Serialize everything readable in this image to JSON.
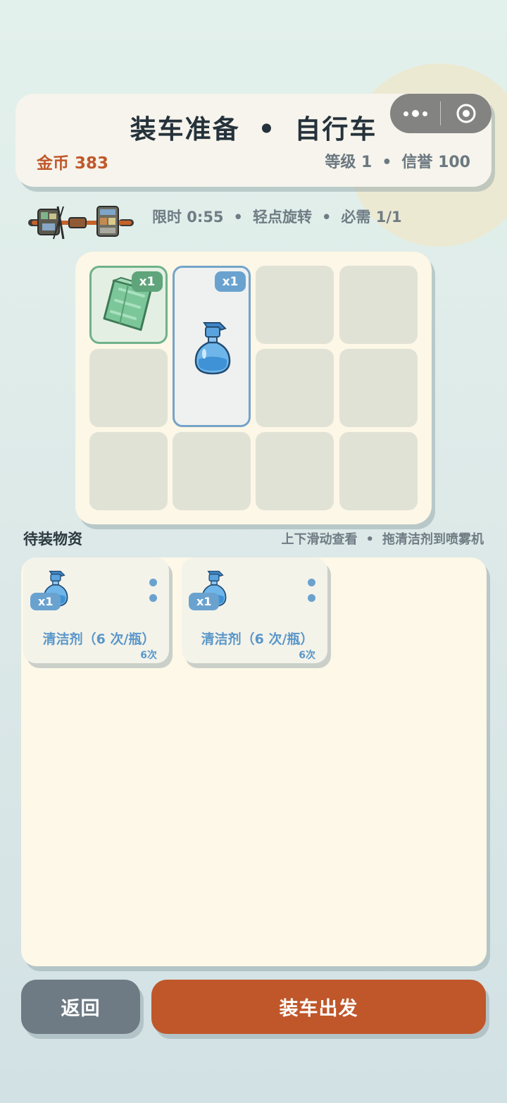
{
  "header": {
    "title_left": "装车准备",
    "title_sep": "•",
    "title_right": "自行车",
    "coins": "金币 383",
    "level": "等级 1",
    "stats_sep": "•",
    "reputation": "信誉 100"
  },
  "info": {
    "timer": "限时 0:55",
    "hint": "轻点旋转",
    "required": "必需 1/1",
    "sep": "•"
  },
  "board": {
    "items": [
      {
        "name": "towel",
        "qty": "x1",
        "accent": "#6fb28a"
      },
      {
        "name": "spray-bottle",
        "qty": "x1",
        "accent": "#75a3c9"
      }
    ]
  },
  "pending": {
    "title": "待装物资",
    "hint_scroll": "上下滑动查看",
    "hint_sep": "•",
    "hint_drag": "拖清洁剂到喷雾机",
    "supplies": [
      {
        "qty": "x1",
        "name": "清洁剂（6 次/瓶）",
        "uses": "6次",
        "icon": "spray-bottle-icon"
      },
      {
        "qty": "x1",
        "name": "清洁剂（6 次/瓶）",
        "uses": "6次",
        "icon": "spray-bottle-icon"
      }
    ]
  },
  "buttons": {
    "back": "返回",
    "go": "装车出发"
  },
  "colors": {
    "accent_orange": "#bf572a",
    "accent_blue": "#6aa2cf",
    "accent_green": "#5fa47a"
  }
}
